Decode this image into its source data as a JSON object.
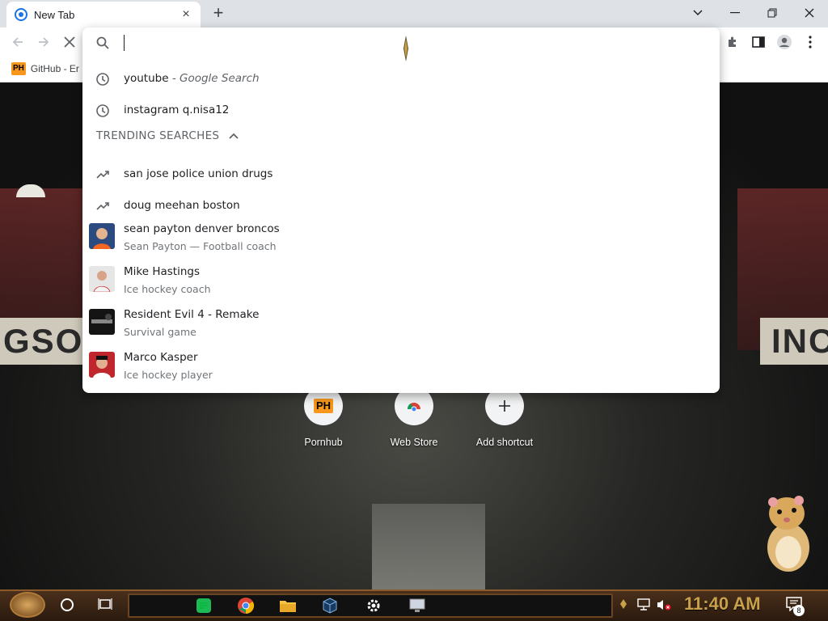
{
  "browser": {
    "tab": {
      "title": "New Tab"
    },
    "new_tab_symbol": "+",
    "bookmark": {
      "badge": "PH",
      "label": "GitHub - Er"
    }
  },
  "omnibox": {
    "input_value": "",
    "history": [
      {
        "query": "youtube",
        "suffix": " - Google Search"
      },
      {
        "query": "instagram q.nisa12",
        "suffix": ""
      }
    ],
    "trending_header": "TRENDING SEARCHES",
    "trending": [
      "san jose police union drugs",
      "doug meehan boston"
    ],
    "entities": [
      {
        "title": "sean payton denver broncos",
        "subtitle": "Sean Payton — Football coach",
        "thumb_color": "#2b4a80"
      },
      {
        "title": "Mike Hastings",
        "subtitle": "Ice hockey coach",
        "thumb_color": "#d9d9d9"
      },
      {
        "title": "Resident Evil 4 - Remake",
        "subtitle": "Survival game",
        "thumb_color": "#1a1a1a"
      },
      {
        "title": "Marco Kasper",
        "subtitle": "Ice hockey player",
        "thumb_color": "#c0272d"
      }
    ]
  },
  "shortcuts": [
    {
      "label": "Pornhub",
      "icon": "ph-logo"
    },
    {
      "label": "Web Store",
      "icon": "webstore-icon"
    },
    {
      "label": "Add shortcut",
      "icon": "plus-icon"
    }
  ],
  "background_sign": {
    "left": "GSO",
    "right": "INC"
  },
  "taskbar": {
    "clock": "11:40 AM",
    "notification_count": "8"
  },
  "colors": {
    "ph_orange": "#f7971d",
    "clock_gold": "#c9a14a"
  }
}
